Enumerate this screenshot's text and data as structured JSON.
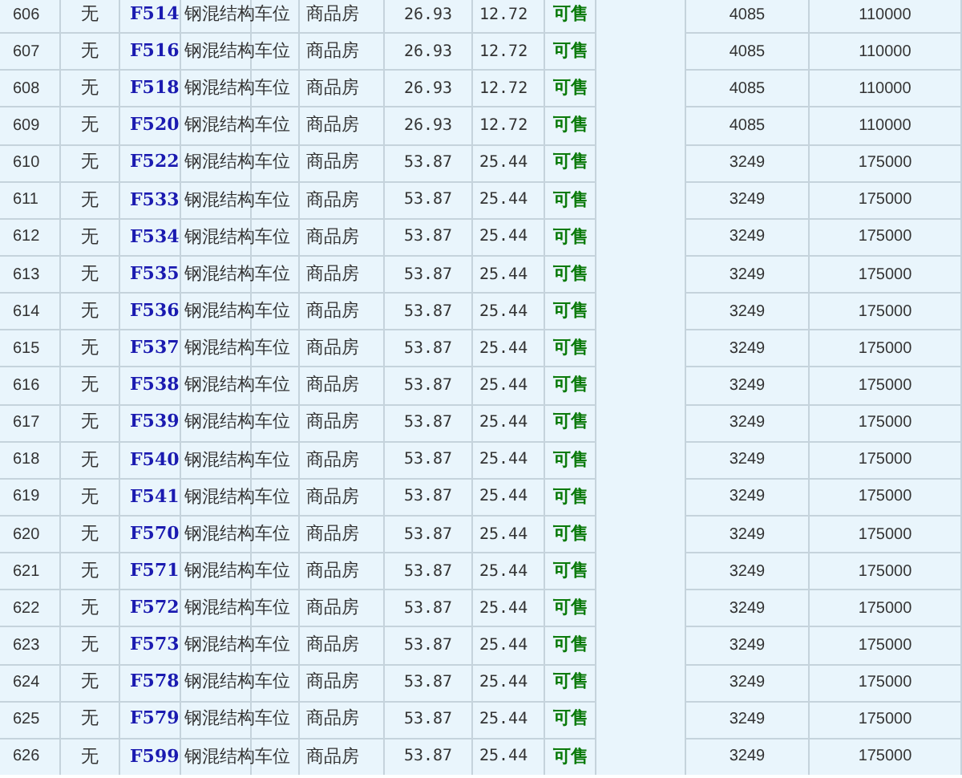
{
  "table": {
    "rows": [
      {
        "cells": [
          "606",
          "无",
          "F514",
          "钢混结构",
          "车位",
          "商品房",
          "26.93",
          "12.72",
          "可售",
          "4085",
          "110000"
        ]
      },
      {
        "cells": [
          "607",
          "无",
          "F516",
          "钢混结构",
          "车位",
          "商品房",
          "26.93",
          "12.72",
          "可售",
          "4085",
          "110000"
        ]
      },
      {
        "cells": [
          "608",
          "无",
          "F518",
          "钢混结构",
          "车位",
          "商品房",
          "26.93",
          "12.72",
          "可售",
          "4085",
          "110000"
        ]
      },
      {
        "cells": [
          "609",
          "无",
          "F520",
          "钢混结构",
          "车位",
          "商品房",
          "26.93",
          "12.72",
          "可售",
          "4085",
          "110000"
        ]
      },
      {
        "cells": [
          "610",
          "无",
          "F522",
          "钢混结构",
          "车位",
          "商品房",
          "53.87",
          "25.44",
          "可售",
          "3249",
          "175000"
        ]
      },
      {
        "cells": [
          "611",
          "无",
          "F533",
          "钢混结构",
          "车位",
          "商品房",
          "53.87",
          "25.44",
          "可售",
          "3249",
          "175000"
        ]
      },
      {
        "cells": [
          "612",
          "无",
          "F534",
          "钢混结构",
          "车位",
          "商品房",
          "53.87",
          "25.44",
          "可售",
          "3249",
          "175000"
        ]
      },
      {
        "cells": [
          "613",
          "无",
          "F535",
          "钢混结构",
          "车位",
          "商品房",
          "53.87",
          "25.44",
          "可售",
          "3249",
          "175000"
        ]
      },
      {
        "cells": [
          "614",
          "无",
          "F536",
          "钢混结构",
          "车位",
          "商品房",
          "53.87",
          "25.44",
          "可售",
          "3249",
          "175000"
        ]
      },
      {
        "cells": [
          "615",
          "无",
          "F537",
          "钢混结构",
          "车位",
          "商品房",
          "53.87",
          "25.44",
          "可售",
          "3249",
          "175000"
        ]
      },
      {
        "cells": [
          "616",
          "无",
          "F538",
          "钢混结构",
          "车位",
          "商品房",
          "53.87",
          "25.44",
          "可售",
          "3249",
          "175000"
        ]
      },
      {
        "cells": [
          "617",
          "无",
          "F539",
          "钢混结构",
          "车位",
          "商品房",
          "53.87",
          "25.44",
          "可售",
          "3249",
          "175000"
        ]
      },
      {
        "cells": [
          "618",
          "无",
          "F540",
          "钢混结构",
          "车位",
          "商品房",
          "53.87",
          "25.44",
          "可售",
          "3249",
          "175000"
        ]
      },
      {
        "cells": [
          "619",
          "无",
          "F541",
          "钢混结构",
          "车位",
          "商品房",
          "53.87",
          "25.44",
          "可售",
          "3249",
          "175000"
        ]
      },
      {
        "cells": [
          "620",
          "无",
          "F570",
          "钢混结构",
          "车位",
          "商品房",
          "53.87",
          "25.44",
          "可售",
          "3249",
          "175000"
        ]
      },
      {
        "cells": [
          "621",
          "无",
          "F571",
          "钢混结构",
          "车位",
          "商品房",
          "53.87",
          "25.44",
          "可售",
          "3249",
          "175000"
        ]
      },
      {
        "cells": [
          "622",
          "无",
          "F572",
          "钢混结构",
          "车位",
          "商品房",
          "53.87",
          "25.44",
          "可售",
          "3249",
          "175000"
        ]
      },
      {
        "cells": [
          "623",
          "无",
          "F573",
          "钢混结构",
          "车位",
          "商品房",
          "53.87",
          "25.44",
          "可售",
          "3249",
          "175000"
        ]
      },
      {
        "cells": [
          "624",
          "无",
          "F578",
          "钢混结构",
          "车位",
          "商品房",
          "53.87",
          "25.44",
          "可售",
          "3249",
          "175000"
        ]
      },
      {
        "cells": [
          "625",
          "无",
          "F579",
          "钢混结构",
          "车位",
          "商品房",
          "53.87",
          "25.44",
          "可售",
          "3249",
          "175000"
        ]
      },
      {
        "cells": [
          "626",
          "无",
          "F599",
          "钢混结构",
          "车位",
          "商品房",
          "53.87",
          "25.44",
          "可售",
          "3249",
          "175000"
        ]
      }
    ]
  }
}
